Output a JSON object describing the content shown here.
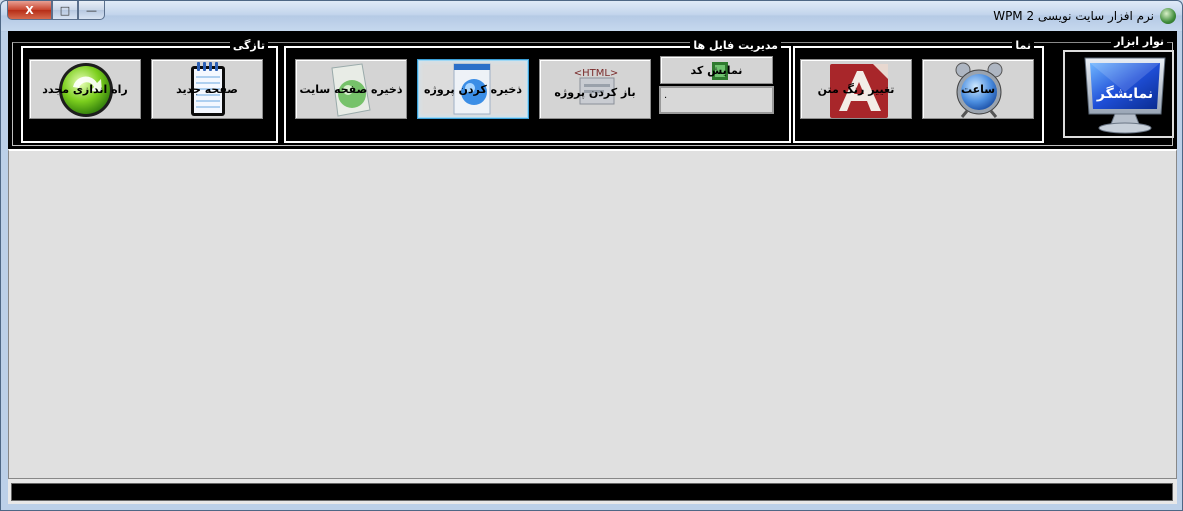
{
  "window": {
    "title": "نرم افزار سایت نویسی WPM 2",
    "controls": {
      "close": "X",
      "maximize": "□",
      "minimize": "—"
    }
  },
  "toolbar": {
    "label": "نوار ابزار",
    "monitor_button": "نمایشگر",
    "groups": {
      "view": {
        "label": "نما",
        "clock_button": "ساعت",
        "change_font_button": "تغییر رنگ متن"
      },
      "file_management": {
        "label": "مدیریت فایل ها",
        "show_code_button": "نمایش کد",
        "open_project_button": "باز کردن پروژه",
        "save_project_button": "ذخیره کردن پروژه",
        "save_site_page_button": "ذخیره صفحه سایت",
        "code_box_value": "."
      },
      "new": {
        "label": "تازگی",
        "new_page_button": "صفحه جدید",
        "restart_button": "راه اندازی مجدد"
      }
    }
  },
  "icons": {
    "app": "globe-icon",
    "monitor": "monitor-icon",
    "clock": "alarm-clock-icon",
    "font": "font-letter-icon",
    "show_code": "code-icon",
    "open_project": "html-file-icon",
    "save_project": "html-document-icon",
    "save_site": "web-page-icon",
    "new_page": "notepad-icon",
    "restart": "refresh-icon"
  },
  "statusbar": {
    "text": ""
  }
}
